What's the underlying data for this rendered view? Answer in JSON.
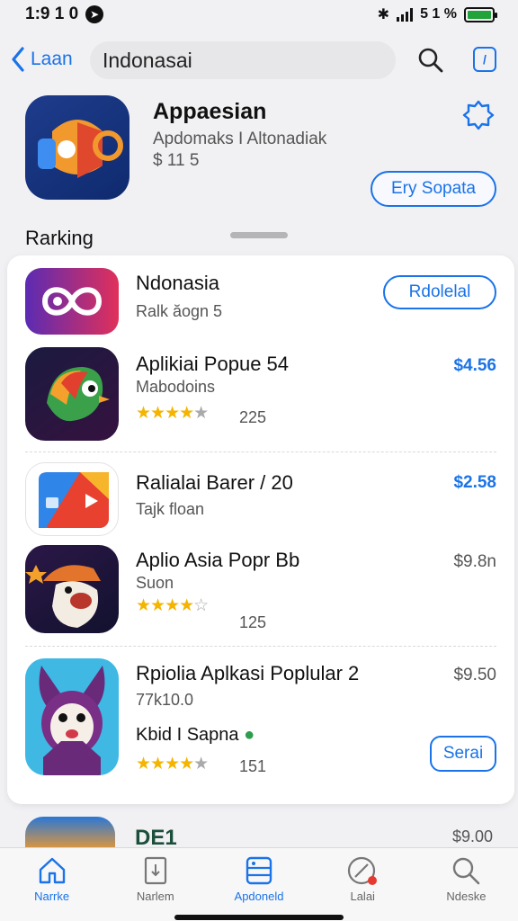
{
  "status": {
    "time": "1:9 1 0",
    "indicator": "5 1 %"
  },
  "nav": {
    "back_label": "Laan",
    "search_text": "Indonasai"
  },
  "hero": {
    "title": "Appaesian",
    "subtitle": "Apdomaks I Altonadiak",
    "price": "$ 11 5",
    "button": "Ery Sopata"
  },
  "section": {
    "label": "Rarking"
  },
  "apps": [
    {
      "name": "Ndonasia",
      "sub": "Ralk ăogn 5",
      "button": "Rdolelal"
    },
    {
      "name": "Aplikiai Popue 54",
      "sub": "Mabodoins",
      "rating_count": "225",
      "price": "$4.56"
    },
    {
      "name": "Ralialai Barer / 20",
      "sub": "Tajk floan",
      "price": "$2.58"
    },
    {
      "name": "Aplio Asia Popr Bb",
      "sub": "Suon",
      "rating_count": "125",
      "price": "$9.8n"
    },
    {
      "name": "Rpiolia Aplkasi Poplular 2",
      "sub": "77k10.0",
      "extra": "Kbid I Sapna",
      "rating_count": "151",
      "price": "$9.50",
      "button": "Serai"
    }
  ],
  "peek": {
    "name": "DE1",
    "price": "$9.00"
  },
  "tabs": [
    {
      "label": "Narrke",
      "icon": "home-icon"
    },
    {
      "label": "Narlem",
      "icon": "document-icon"
    },
    {
      "label": "Apdoneld",
      "icon": "apps-icon"
    },
    {
      "label": "Lalai",
      "icon": "compass-icon"
    },
    {
      "label": "Ndeske",
      "icon": "search-icon"
    }
  ],
  "colors": {
    "accent": "#1a73e8",
    "star": "#f4b400",
    "background": "#f1f1f4"
  }
}
